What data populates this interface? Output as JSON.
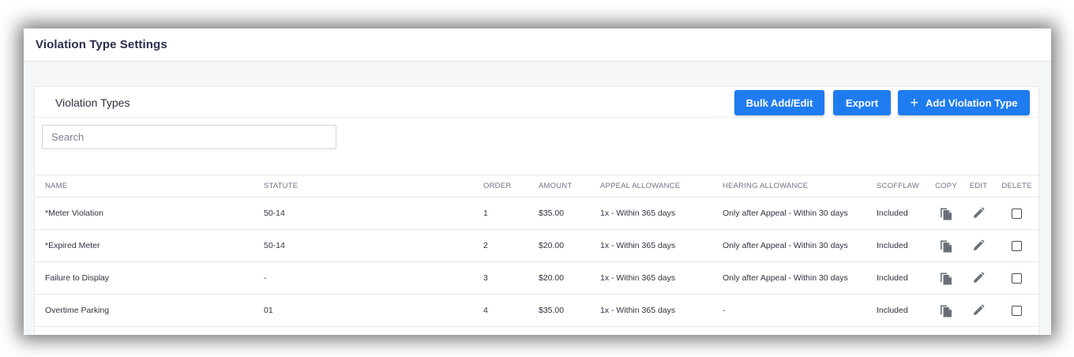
{
  "page": {
    "title": "Violation Type Settings"
  },
  "card": {
    "title": "Violation Types",
    "buttons": {
      "bulk": "Bulk Add/Edit",
      "export": "Export",
      "add": "Add Violation Type"
    }
  },
  "search": {
    "placeholder": "Search"
  },
  "table": {
    "headers": [
      "NAME",
      "STATUTE",
      "ORDER",
      "AMOUNT",
      "APPEAL ALLOWANCE",
      "HEARING ALLOWANCE",
      "SCOFFLAW",
      "COPY",
      "EDIT",
      "DELETE"
    ],
    "rows": [
      {
        "name": "*Meter Violation",
        "statute": "50-14",
        "order": "1",
        "amount": "$35.00",
        "appeal": "1x - Within 365 days",
        "hearing": "Only after Appeal - Within 30 days",
        "scofflaw": "Included"
      },
      {
        "name": "*Expired Meter",
        "statute": "50-14",
        "order": "2",
        "amount": "$20.00",
        "appeal": "1x - Within 365 days",
        "hearing": "Only after Appeal - Within 30 days",
        "scofflaw": "Included"
      },
      {
        "name": "Failure to Display",
        "statute": "-",
        "order": "3",
        "amount": "$20.00",
        "appeal": "1x - Within 365 days",
        "hearing": "Only after Appeal - Within 30 days",
        "scofflaw": "Included"
      },
      {
        "name": "Overtime Parking",
        "statute": "01",
        "order": "4",
        "amount": "$35.00",
        "appeal": "1x - Within 365 days",
        "hearing": "-",
        "scofflaw": "Included"
      },
      {
        "name": "",
        "statute": "",
        "order": "",
        "amount": "",
        "appeal": "",
        "hearing": "",
        "scofflaw": ""
      }
    ]
  },
  "icons": {
    "copy": "copy-icon",
    "edit": "pencil-icon",
    "delete": "checkbox"
  },
  "colors": {
    "primary": "#1f7cf0",
    "title": "#2a2e4d",
    "icon": "#6b6e78"
  }
}
